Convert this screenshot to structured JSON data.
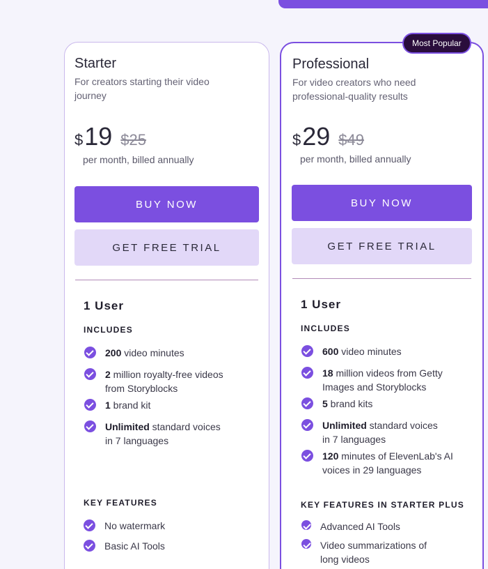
{
  "colors": {
    "accent": "#7b4fe0",
    "accent_light": "#e2d8f8",
    "badge_bg": "#2a0d3c"
  },
  "plans": [
    {
      "title": "Starter",
      "subtitle": "For creators starting their video journey",
      "currency": "$",
      "price": "19",
      "old_price": "$25",
      "billing": "per month, billed annually",
      "buy_label": "BUY NOW",
      "trial_label": "GET FREE TRIAL",
      "users": "1 User",
      "includes_label": "INCLUDES",
      "includes": [
        {
          "bold": "200",
          "text": " video minutes"
        },
        {
          "bold": "2",
          "text": " million royalty-free videos from Storyblocks"
        },
        {
          "bold": "1",
          "text": " brand kit"
        },
        {
          "bold": "Unlimited",
          "text": " standard voices in 7 languages"
        }
      ],
      "features_label": "KEY FEATURES",
      "features": [
        "No watermark",
        "Basic AI Tools"
      ]
    },
    {
      "badge": "Most Popular",
      "title": "Professional",
      "subtitle": "For video creators who need professional-quality results",
      "currency": "$",
      "price": "29",
      "old_price": "$49",
      "billing": "per month, billed annually",
      "buy_label": "BUY NOW",
      "trial_label": "GET FREE TRIAL",
      "users": "1 User",
      "includes_label": "INCLUDES",
      "includes": [
        {
          "bold": "600",
          "text": " video minutes"
        },
        {
          "bold": "18",
          "text": " million videos from Getty Images and Storyblocks"
        },
        {
          "bold": "5",
          "text": " brand kits"
        },
        {
          "bold": "Unlimited",
          "text": " standard voices in 7 languages"
        },
        {
          "bold": "120",
          "text": " minutes of ElevenLab's AI voices in 29 languages"
        }
      ],
      "features_label": "KEY FEATURES IN STARTER PLUS",
      "features": [
        "Advanced AI Tools",
        "Video summarizations of long videos"
      ]
    }
  ]
}
